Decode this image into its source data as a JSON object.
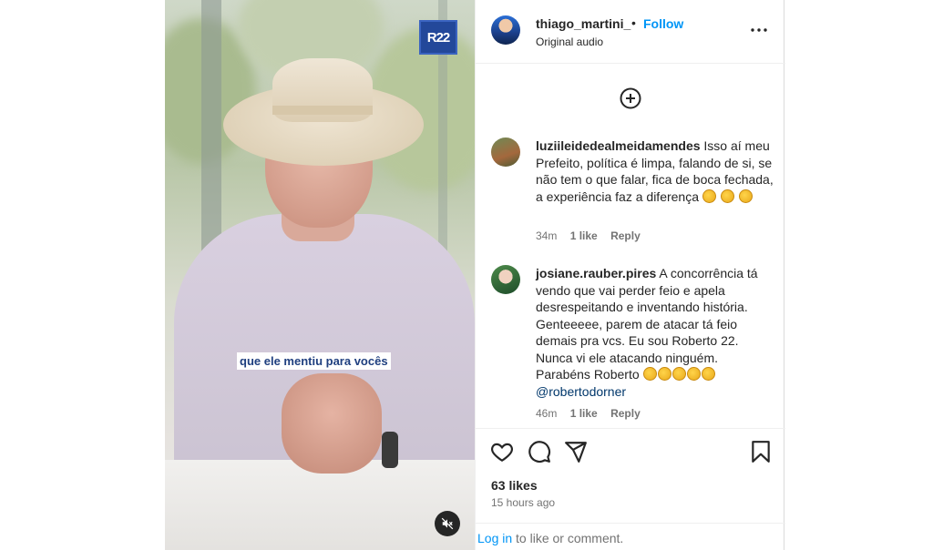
{
  "media": {
    "logo_text": "R22",
    "caption": "que ele mentiu para vocês"
  },
  "header": {
    "username": "thiago_martini_",
    "separator": "•",
    "follow_label": "Follow",
    "audio": "Original audio"
  },
  "comments": [
    {
      "username": "luziileidedealmeidamendes",
      "text": "Isso aí meu Prefeito, política é limpa, falando de si, se não tem o que falar, fica de boca fechada, a experiência faz a diferença",
      "time": "34m",
      "likes": "1 like",
      "reply": "Reply"
    },
    {
      "username": "josiane.rauber.pires",
      "text": "A concorrência tá vendo que vai perder feio e apela desrespeitando e inventando história. Genteeeee, parem de atacar tá feio demais pra vcs. Eu sou Roberto 22. Nunca vi ele atacando ninguém. Parabéns Roberto",
      "mention": "@robertodorner",
      "time": "46m",
      "likes": "1 like",
      "reply": "Reply"
    }
  ],
  "stats": {
    "likes": "63 likes",
    "posted": "15 hours ago"
  },
  "footer": {
    "login_link": "Log in",
    "login_rest": "to like or comment."
  },
  "colors": {
    "accent": "#0095f6",
    "text": "#262626",
    "muted": "#737373"
  }
}
